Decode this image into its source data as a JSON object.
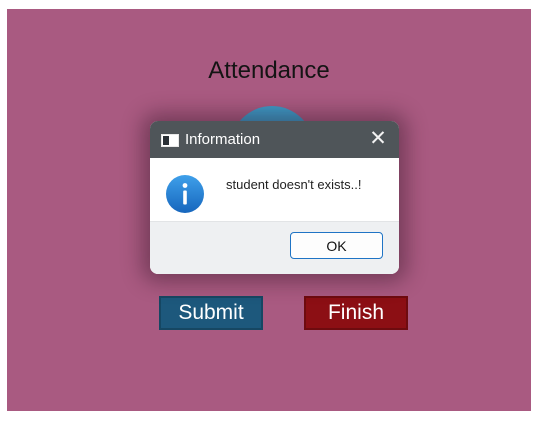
{
  "app": {
    "title": "Attendance",
    "buttons": {
      "submit_label": "Submit",
      "finish_label": "Finish"
    }
  },
  "dialog": {
    "title": "Information",
    "close_glyph": "✕",
    "message": "student doesn't exists..!",
    "ok_label": "OK",
    "icon": "info-icon"
  },
  "colors": {
    "background": "#a95a81",
    "submit_button": "#1d587c",
    "finish_button": "#8c0f14",
    "avatar": "#3d9bc9",
    "dialog_titlebar": "#4f5559",
    "info_icon": "#1f7fd1"
  }
}
